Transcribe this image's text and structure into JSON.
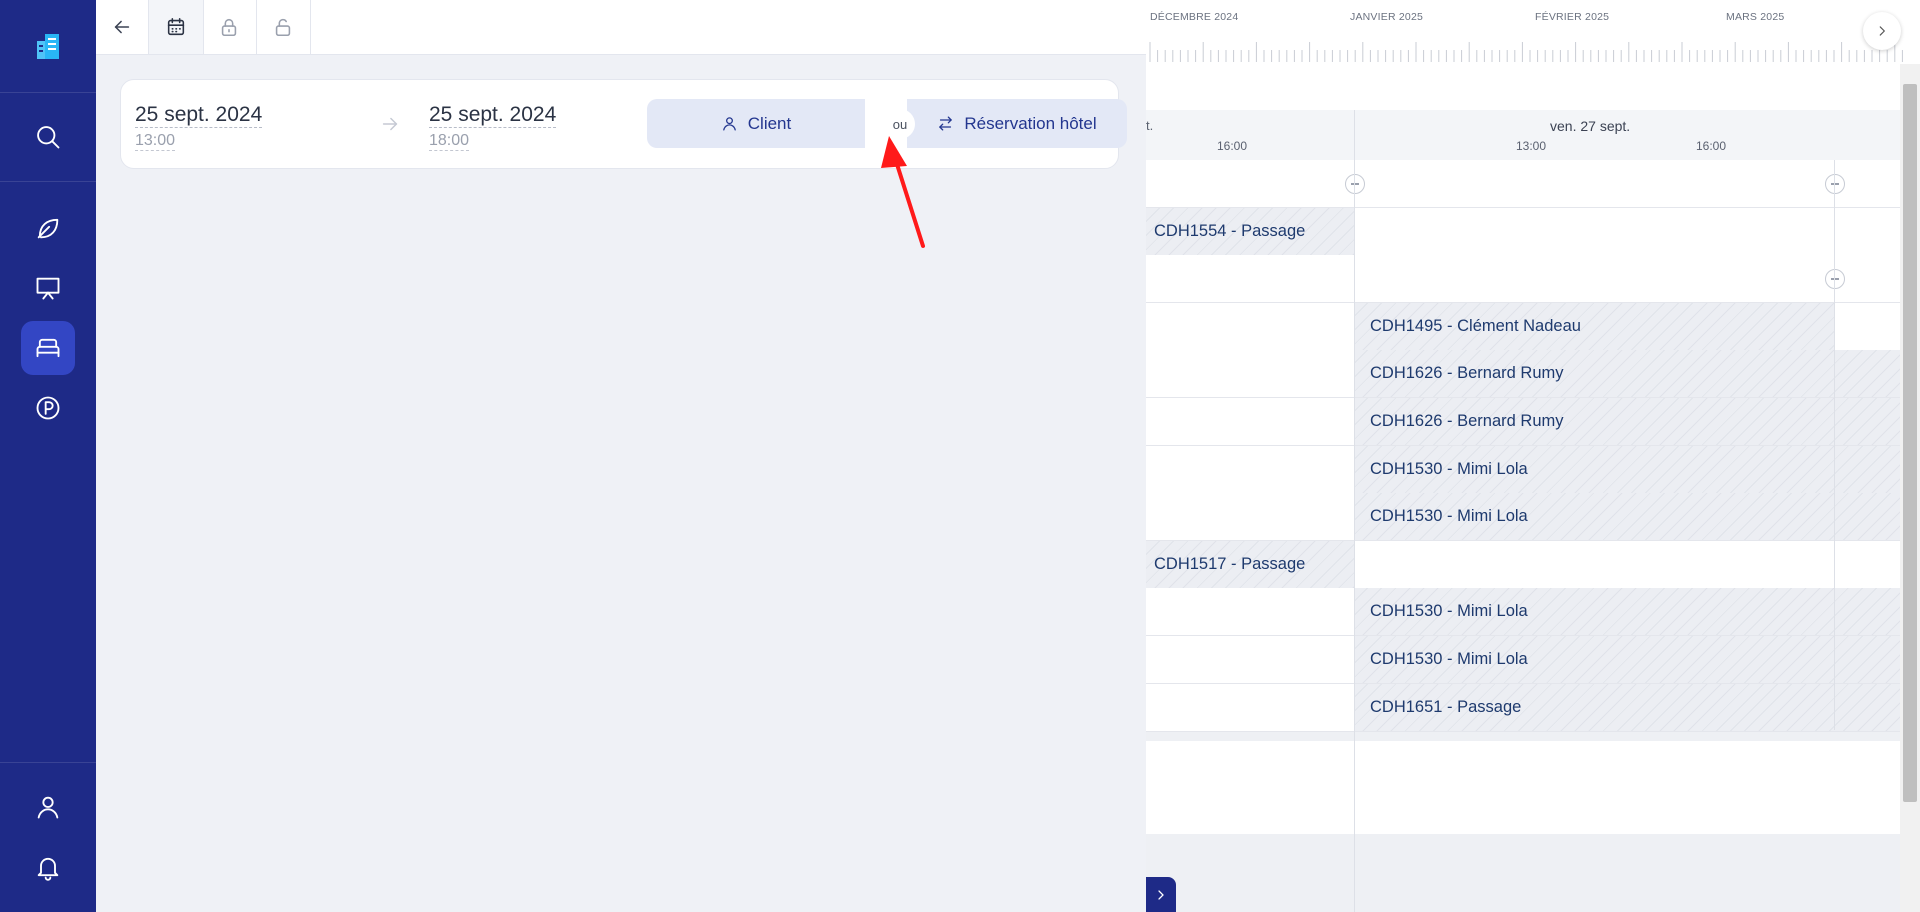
{
  "sidebar": {
    "logo": "hotel-logo",
    "items": [
      {
        "name": "search",
        "icon": "search-icon"
      },
      {
        "name": "leaf",
        "icon": "leaf-icon"
      },
      {
        "name": "presentation",
        "icon": "presentation-icon"
      },
      {
        "name": "rooms",
        "icon": "bed-icon",
        "active": true
      },
      {
        "name": "parking",
        "icon": "parking-icon"
      }
    ],
    "bottom_items": [
      {
        "name": "profile",
        "icon": "user-icon"
      },
      {
        "name": "notifications",
        "icon": "bell-icon"
      }
    ]
  },
  "tabs": [
    {
      "name": "back",
      "icon": "arrow-left-icon"
    },
    {
      "name": "calendar",
      "icon": "calendar-icon",
      "active": true
    },
    {
      "name": "lock",
      "icon": "lock-icon"
    },
    {
      "name": "unlock",
      "icon": "unlock-icon"
    }
  ],
  "booking_form": {
    "start_date": "25 sept. 2024",
    "start_time": "13:00",
    "end_date": "25 sept. 2024",
    "end_time": "18:00",
    "client_button": "Client",
    "or_label": "ou",
    "hotel_button": "Réservation hôtel"
  },
  "timeline": {
    "months": [
      "DÉCEMBRE 2024",
      "JANVIER 2025",
      "FÉVRIER 2025",
      "MARS 2025"
    ],
    "prev_day_label": "t.",
    "day_label": "ven. 27 sept.",
    "hours": [
      "16:00",
      "13:00",
      "16:00"
    ],
    "rows": [
      {
        "type": "group"
      },
      {
        "left": "CDH1554 - Passage",
        "right": ""
      },
      {
        "type": "group"
      },
      {
        "left": "",
        "right": "CDH1495 - Clément Nadeau"
      },
      {
        "left": "",
        "right": "CDH1626 - Bernard Rumy"
      },
      {
        "left": "",
        "right": "CDH1626 - Bernard Rumy"
      },
      {
        "left": "",
        "right": "CDH1530 - Mimi Lola"
      },
      {
        "left": "",
        "right": "CDH1530 - Mimi Lola"
      },
      {
        "left": "CDH1517 - Passage",
        "right": ""
      },
      {
        "left": "",
        "right": "CDH1530 - Mimi Lola"
      },
      {
        "left": "",
        "right": "CDH1530 - Mimi Lola"
      },
      {
        "left": "",
        "right": "CDH1651 - Passage"
      }
    ]
  },
  "colors": {
    "sidebar": "#1e2a87",
    "active": "#3346c4",
    "accent": "#23368f",
    "annotation_arrow": "#ff1a1a"
  }
}
